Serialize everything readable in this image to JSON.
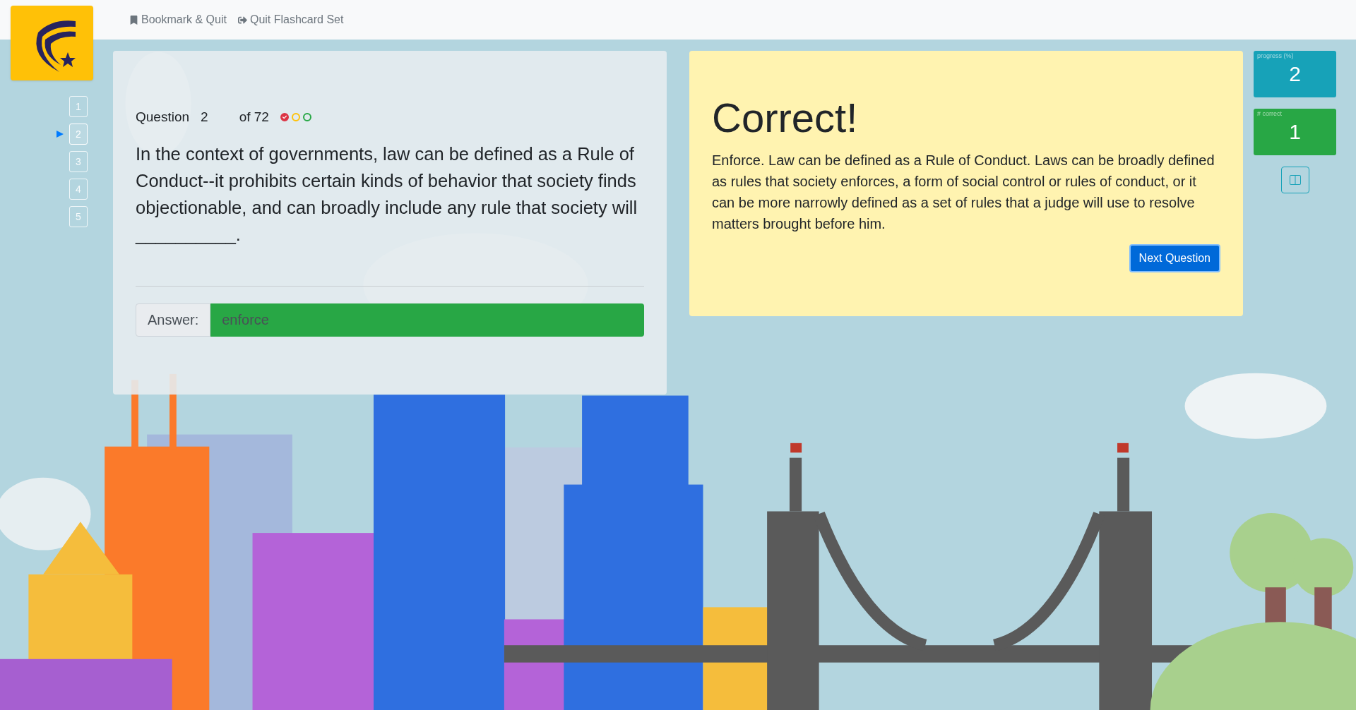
{
  "nav_links": [
    {
      "label": "Bookmark & Quit",
      "kind": "bookmark"
    },
    {
      "label": "Quit Flashcard Set",
      "kind": "quit"
    }
  ],
  "question_nav": [
    {
      "label": "1",
      "selected": false
    },
    {
      "label": "2",
      "selected": true
    },
    {
      "label": "3",
      "selected": false
    },
    {
      "label": "4",
      "selected": false
    },
    {
      "label": "5",
      "selected": false
    }
  ],
  "question": {
    "label": "Question",
    "number": "2",
    "total": "of 72",
    "indicators": [
      {
        "color": "#dc3545",
        "checked": true
      },
      {
        "color": "#ffc107",
        "checked": false
      },
      {
        "color": "#28a745",
        "checked": false
      }
    ],
    "text": "In the context of governments, law can be defined as a Rule of Conduct--it prohibits certain kinds of behavior that society finds objectionable, and can broadly include any rule that society will __________.",
    "answer_label": "Answer:",
    "answer_value": "enforce",
    "correct": true
  },
  "feedback": {
    "title": "Correct!",
    "explanation": "Enforce. Law can be defined as a Rule of Conduct. Laws can be broadly defined as rules that society enforces, a form of social control or rules of conduct, or it can be more narrowly defined as a set of rules that a judge will use to resolve matters brought before him.",
    "button": "Next Question"
  },
  "stats": [
    {
      "label": "progress (%)",
      "value": "2",
      "color": "#17a2b8"
    },
    {
      "label": "# correct",
      "value": "1",
      "color": "#28a745"
    }
  ]
}
